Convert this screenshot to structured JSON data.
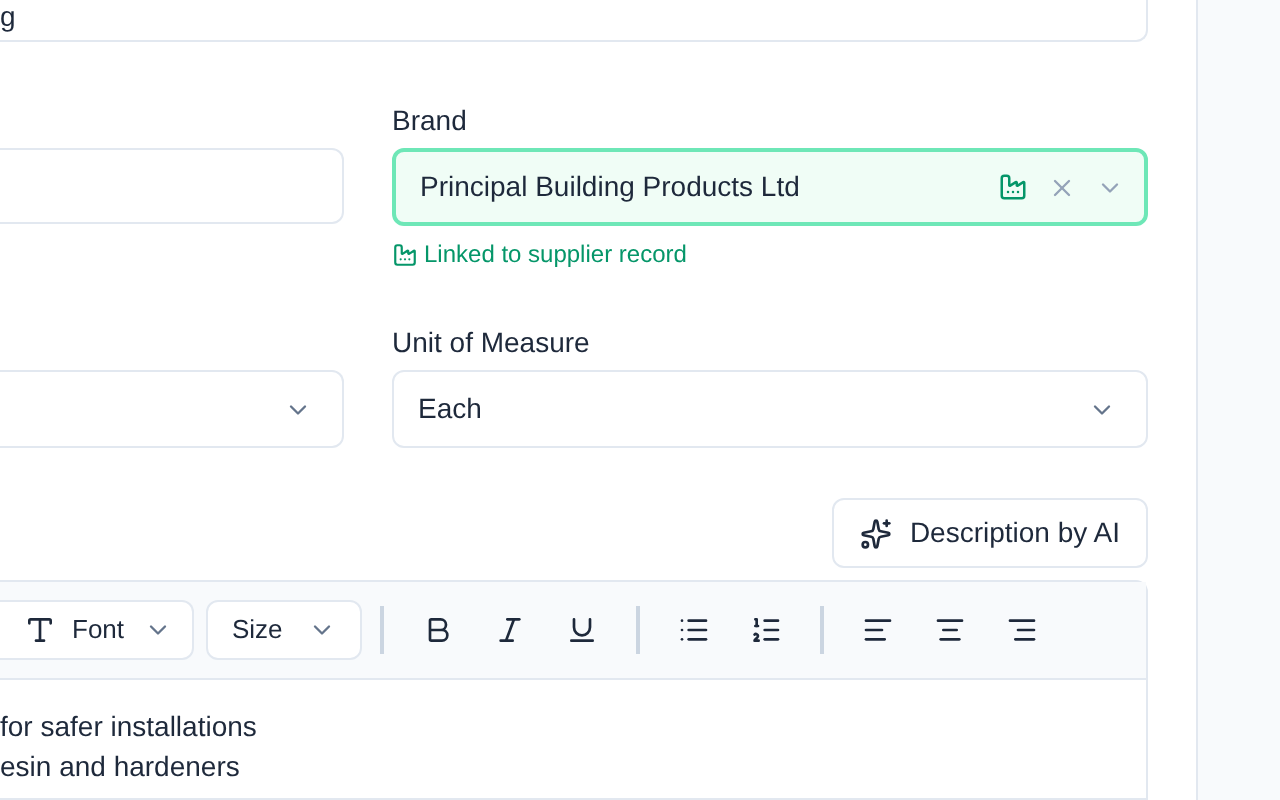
{
  "top_field": {
    "value": "g"
  },
  "left_field": {
    "kind": "input"
  },
  "left_select": {
    "kind": "select"
  },
  "brand": {
    "label": "Brand",
    "value": "Principal Building Products Ltd",
    "linked": true,
    "note": "Linked to supplier record"
  },
  "unit_of_measure": {
    "label": "Unit of Measure",
    "value": "Each"
  },
  "ai_button": {
    "label": "Description by AI"
  },
  "editor": {
    "toolbar": [
      {
        "kind": "font",
        "label": "Font"
      },
      {
        "kind": "size",
        "label": "Size"
      },
      {
        "kind": "separator"
      },
      {
        "kind": "bold"
      },
      {
        "kind": "italic"
      },
      {
        "kind": "underline"
      },
      {
        "kind": "separator"
      },
      {
        "kind": "bullets"
      },
      {
        "kind": "numbers"
      },
      {
        "kind": "separator"
      },
      {
        "kind": "align-left"
      },
      {
        "kind": "align-center"
      },
      {
        "kind": "align-right"
      }
    ],
    "lines": [
      "for safer installations",
      "esin and hardeners"
    ]
  }
}
